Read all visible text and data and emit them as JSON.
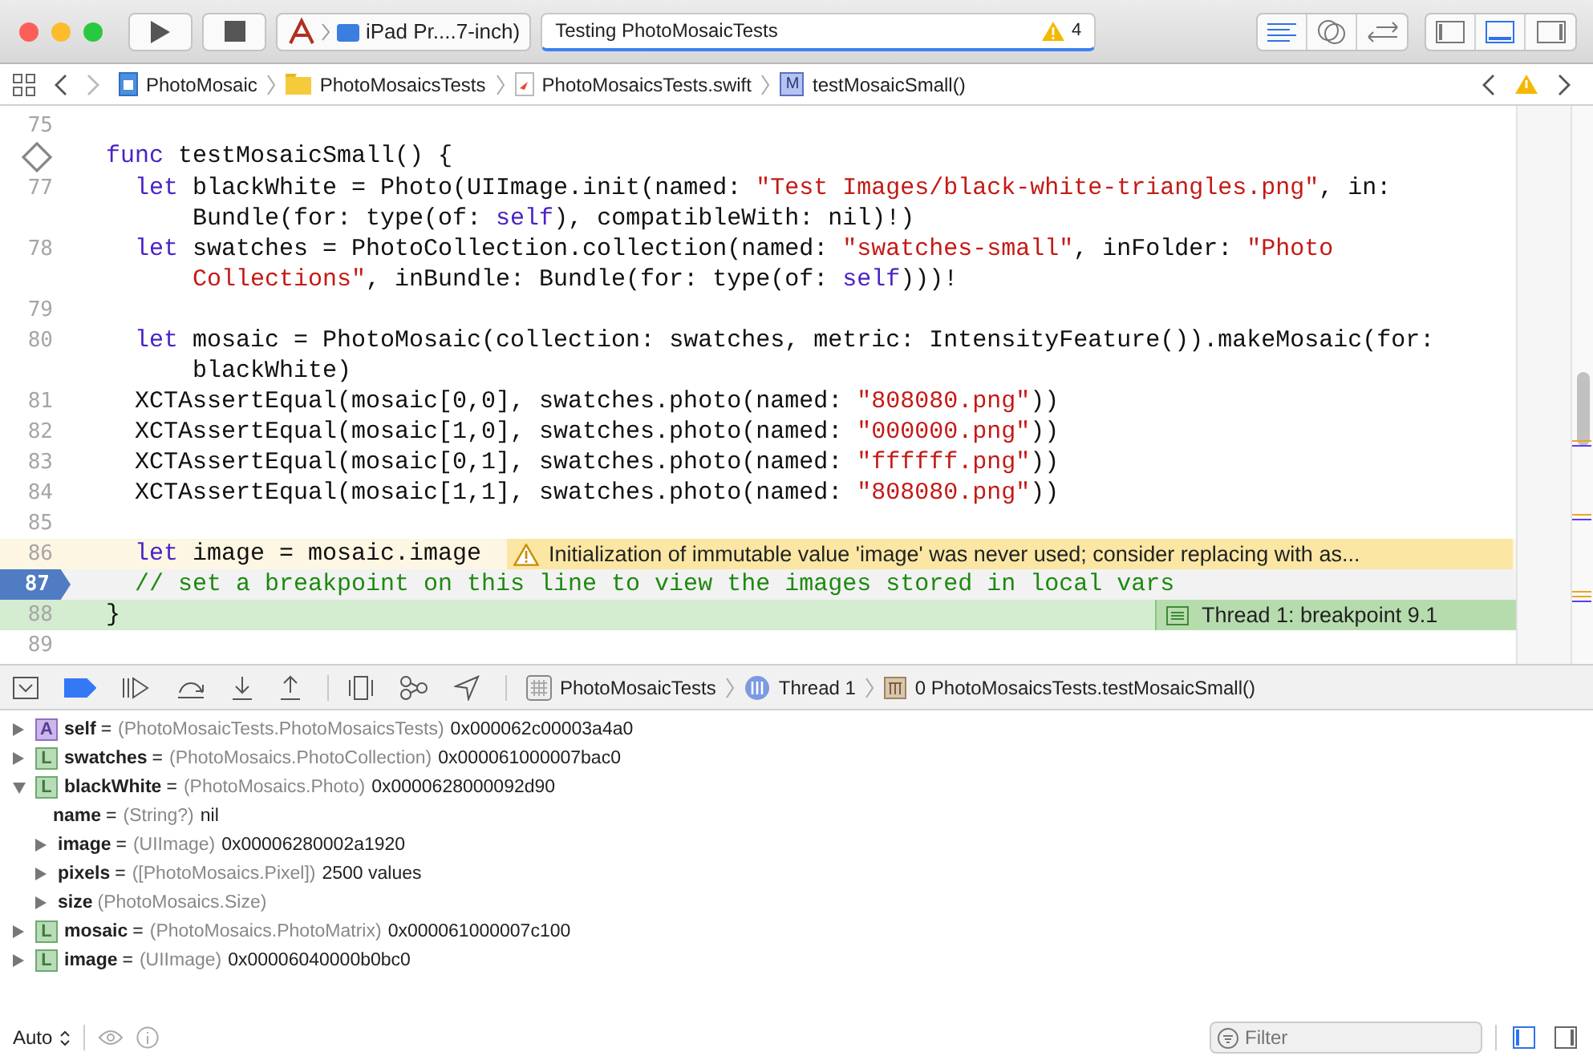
{
  "toolbar": {
    "scheme": {
      "target": "iPad Pr....7-inch)"
    },
    "activity": {
      "text": "Testing PhotoMosaicTests",
      "warning_count": "4"
    },
    "editor_modes": [
      {
        "kind": "standard",
        "selected": true
      },
      {
        "kind": "assistant",
        "selected": false
      },
      {
        "kind": "version",
        "selected": false
      }
    ],
    "panels": [
      {
        "kind": "left",
        "selected": false
      },
      {
        "kind": "bottom",
        "selected": true
      },
      {
        "kind": "right",
        "selected": false
      }
    ]
  },
  "jump_bar": {
    "breadcrumbs": [
      {
        "kind": "project",
        "label": "PhotoMosaic"
      },
      {
        "kind": "folder",
        "label": "PhotoMosaicsTests"
      },
      {
        "kind": "swift",
        "label": "PhotoMosaicsTests.swift"
      },
      {
        "kind": "method",
        "badge": "M",
        "label": "testMosaicSmall()"
      }
    ]
  },
  "editor": {
    "lines": [
      {
        "number": "75",
        "kind": "plain"
      },
      {
        "kind": "test",
        "rows": [
          {
            "tokens": [
              {
                "kind": "keyword",
                "text": "  func"
              },
              {
                "kind": "plain",
                "text": " testMosaicSmall() {"
              }
            ]
          }
        ]
      },
      {
        "number": "77",
        "kind": "plain",
        "rows": [
          {
            "tokens": [
              {
                "kind": "keyword",
                "text": "    let"
              },
              {
                "kind": "plain",
                "text": " blackWhite = Photo(UIImage.init(named: "
              },
              {
                "kind": "string",
                "text": "\"Test Images/black-white-triangles.png\""
              },
              {
                "kind": "plain",
                "text": ", in:"
              }
            ]
          },
          {
            "tokens": [
              {
                "kind": "plain",
                "text": "        Bundle(for: type(of: "
              },
              {
                "kind": "keyword",
                "text": "self"
              },
              {
                "kind": "plain",
                "text": "), compatibleWith: nil)!)"
              }
            ]
          }
        ]
      },
      {
        "number": "78",
        "kind": "plain",
        "rows": [
          {
            "tokens": [
              {
                "kind": "keyword",
                "text": "    let"
              },
              {
                "kind": "plain",
                "text": " swatches = PhotoCollection.collection(named: "
              },
              {
                "kind": "string",
                "text": "\"swatches-small\""
              },
              {
                "kind": "plain",
                "text": ", inFolder: "
              },
              {
                "kind": "string",
                "text": "\"Photo"
              }
            ]
          },
          {
            "tokens": [
              {
                "kind": "string",
                "text": "        Collections\""
              },
              {
                "kind": "plain",
                "text": ", inBundle: Bundle(for: type(of: "
              },
              {
                "kind": "keyword",
                "text": "self"
              },
              {
                "kind": "plain",
                "text": ")))!"
              }
            ]
          }
        ]
      },
      {
        "number": "79",
        "kind": "plain"
      },
      {
        "number": "80",
        "kind": "plain",
        "rows": [
          {
            "tokens": [
              {
                "kind": "keyword",
                "text": "    let"
              },
              {
                "kind": "plain",
                "text": " mosaic = PhotoMosaic(collection: swatches, metric: IntensityFeature()).makeMosaic(for:"
              }
            ]
          },
          {
            "tokens": [
              {
                "kind": "plain",
                "text": "        blackWhite)"
              }
            ]
          }
        ]
      },
      {
        "number": "81",
        "kind": "plain",
        "rows": [
          {
            "tokens": [
              {
                "kind": "plain",
                "text": "    XCTAssertEqual(mosaic[0,0], swatches.photo(named: "
              },
              {
                "kind": "string",
                "text": "\"808080.png\""
              },
              {
                "kind": "plain",
                "text": "))"
              }
            ]
          }
        ]
      },
      {
        "number": "82",
        "kind": "plain",
        "rows": [
          {
            "tokens": [
              {
                "kind": "plain",
                "text": "    XCTAssertEqual(mosaic[1,0], swatches.photo(named: "
              },
              {
                "kind": "string",
                "text": "\"000000.png\""
              },
              {
                "kind": "plain",
                "text": "))"
              }
            ]
          }
        ]
      },
      {
        "number": "83",
        "kind": "plain",
        "rows": [
          {
            "tokens": [
              {
                "kind": "plain",
                "text": "    XCTAssertEqual(mosaic[0,1], swatches.photo(named: "
              },
              {
                "kind": "string",
                "text": "\"ffffff.png\""
              },
              {
                "kind": "plain",
                "text": "))"
              }
            ]
          }
        ]
      },
      {
        "number": "84",
        "kind": "plain",
        "rows": [
          {
            "tokens": [
              {
                "kind": "plain",
                "text": "    XCTAssertEqual(mosaic[1,1], swatches.photo(named: "
              },
              {
                "kind": "string",
                "text": "\"808080.png\""
              },
              {
                "kind": "plain",
                "text": "))"
              }
            ]
          }
        ]
      },
      {
        "number": "85",
        "kind": "plain"
      },
      {
        "number": "86",
        "kind": "warning",
        "rows": [
          {
            "tokens": [
              {
                "kind": "keyword",
                "text": "    let"
              },
              {
                "kind": "plain",
                "text": " image = mosaic.image"
              }
            ]
          }
        ],
        "annotation": "Initialization of immutable value 'image' was never used; consider replacing with as..."
      },
      {
        "number": "87",
        "kind": "current",
        "rows": [
          {
            "tokens": [
              {
                "kind": "comment",
                "text": "    // set a breakpoint on this line to view the images stored in local vars"
              }
            ]
          }
        ]
      },
      {
        "number": "88",
        "kind": "stopped",
        "rows": [
          {
            "tokens": [
              {
                "kind": "plain",
                "text": "  }"
              }
            ]
          }
        ],
        "annotation": "Thread 1: breakpoint 9.1"
      },
      {
        "number": "89",
        "kind": "plain"
      }
    ]
  },
  "debug_bar": {
    "breakpoints_active": true,
    "path": [
      {
        "kind": "app",
        "label": "PhotoMosaicTests"
      },
      {
        "kind": "thread",
        "label": "Thread 1"
      },
      {
        "kind": "frame",
        "label": "0 PhotoMosaicsTests.testMosaicSmall()"
      }
    ]
  },
  "variables": [
    {
      "badge": "A",
      "kind": "argument",
      "name": "self",
      "operator": "=",
      "type": "(PhotoMosaicTests.PhotoMosaicsTests)",
      "value": "0x000062c00003a4a0",
      "expanded": false
    },
    {
      "badge": "L",
      "kind": "local",
      "name": "swatches",
      "operator": "=",
      "type": "(PhotoMosaics.PhotoCollection)",
      "value": "0x000061000007bac0",
      "expanded": false
    },
    {
      "badge": "L",
      "kind": "local",
      "name": "blackWhite",
      "operator": "=",
      "type": "(PhotoMosaics.Photo)",
      "value": "0x0000628000092d90",
      "expanded": true,
      "children": [
        {
          "name": "name",
          "operator": "=",
          "type": "(String?)",
          "value": "nil"
        },
        {
          "name": "image",
          "operator": "=",
          "type": "(UIImage)",
          "value": "0x00006280002a1920",
          "expanded": false
        },
        {
          "name": "pixels",
          "operator": "=",
          "type": "([PhotoMosaics.Pixel])",
          "value": "2500 values",
          "expanded": false
        },
        {
          "name": "size",
          "type": "(PhotoMosaics.Size)",
          "expanded": false
        }
      ]
    },
    {
      "badge": "L",
      "kind": "local",
      "name": "mosaic",
      "operator": "=",
      "type": "(PhotoMosaics.PhotoMatrix)",
      "value": "0x000061000007c100",
      "expanded": false
    },
    {
      "badge": "L",
      "kind": "local",
      "name": "image",
      "operator": "=",
      "type": "(UIImage)",
      "value": "0x00006040000b0bc0",
      "expanded": false
    }
  ],
  "bottom_bar": {
    "mode": "Auto",
    "filter": {
      "placeholder": "Filter"
    },
    "views": [
      {
        "kind": "variables",
        "selected": true
      },
      {
        "kind": "console",
        "selected": false
      }
    ]
  }
}
